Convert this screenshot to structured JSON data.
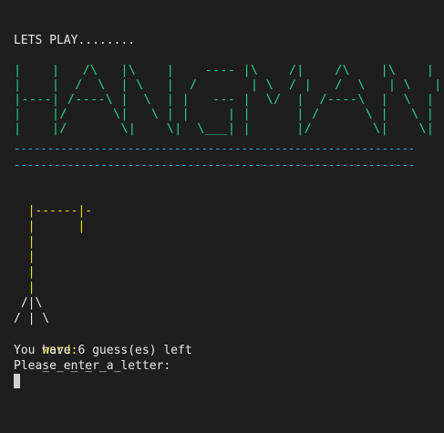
{
  "intro": "LETS PLAY........",
  "banner": [
    "|    |   /\\   |\\    |    ---- |\\    /|    /\\    |\\    |  |",
    "|    |  /  \\  | \\   |  /       | \\  / |   /  \\   | \\   |  |",
    "|----| /----\\ |  \\  | |   --- |  \\/  |  /----\\  |  \\  |  |",
    "|    |/      \\|   \\ | |     | |      | /      \\ |   \\ |  |",
    "|    |/       \\|    \\|  \\___| |      |/        \\|    \\|  ."
  ],
  "separator": "------------------------------------------------------------",
  "gallows": [
    "  |------|-",
    "  |      |",
    "  |",
    "  |",
    "  |",
    "  |",
    " /|\\",
    "/ | \\"
  ],
  "word_label": "word:",
  "word_value": "_ _ _ _ _ _",
  "guesses_text": "You have 6 guess(es) left",
  "prompt_text": "Please enter a letter:",
  "colors": {
    "background": "#1e1e1e",
    "text": "#e8e8e8",
    "banner": "#23d18b",
    "separator": "#29b8db",
    "gallows": "#e5e510"
  }
}
